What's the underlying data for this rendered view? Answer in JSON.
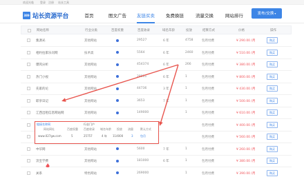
{
  "topbar": {
    "welcome": "欢迎光临",
    "login": "登录",
    "register": "注册",
    "tools": "站长工具"
  },
  "header": {
    "logo_mark": "389",
    "logo_text": "站长资源平台",
    "nav": [
      "首页",
      "图文广告",
      "友链买卖",
      "免费换链",
      "流量交换",
      "网站排行"
    ],
    "active_nav": "友链买卖",
    "publish_label": "发布/交换",
    "publish_caret": "▾",
    "accent": "#3d85e6"
  },
  "table": {
    "headers": [
      "网站名称",
      "行业分类",
      "百度权重",
      "百度收录",
      "域名年龄",
      "投放",
      "结算方式",
      "价格",
      "操作"
    ],
    "rows": [
      {
        "name": "集源光",
        "category": "其他网站",
        "weight": "",
        "index": "29527",
        "age": "6 年",
        "count": "4758",
        "settle": "包月付费",
        "price": "¥ 290.00 /月",
        "action": "购买"
      },
      {
        "name": "相约拉家乐问网",
        "category": "技术类",
        "weight": "",
        "index": "5564",
        "age": "6 年",
        "count": "2460",
        "settle": "包月付费",
        "price": "¥ 510.00 /月",
        "action": "购买"
      },
      {
        "name": "爆风分析",
        "category": "其他网站",
        "weight": "",
        "index": "454374",
        "age": "6 年",
        "count": "266",
        "settle": "包月付费",
        "price": "¥ 380.00 /月",
        "action": "购买"
      },
      {
        "name": "热门小视",
        "category": "其他网站",
        "weight": "",
        "index": "28911",
        "age": "6 年",
        "count": "1",
        "settle": "包月付费",
        "price": "¥ 800.00 /月",
        "action": "购买"
      },
      {
        "name": "先家的论",
        "category": "其他网站",
        "weight": "",
        "index": "44736",
        "age": "3 年",
        "count": "1",
        "settle": "包月付费",
        "price": "¥ 430.00 /月",
        "action": "购买"
      },
      {
        "name": "职享日记",
        "category": "其他网站",
        "weight": "",
        "index": "3653",
        "age": "7 年",
        "count": "1",
        "settle": "包月付费",
        "price": "¥ 500.00 /月",
        "action": "购买"
      },
      {
        "name": "江西出租信息网站网",
        "category": "其他网站",
        "weight": "",
        "index": "149000",
        "age": "",
        "count": "1",
        "settle": "包月付费",
        "price": "¥ 610.00 /月",
        "action": "购买"
      },
      {
        "name": "",
        "category": "",
        "weight": "",
        "index": "",
        "age": "",
        "count": "",
        "settle": "包月付费",
        "price": "¥ 400.00 /月",
        "action": "购买"
      },
      {
        "name": "",
        "category": "",
        "weight": "",
        "index": "",
        "age": "",
        "count": "",
        "settle": "包月付费",
        "price": "¥ 560.00 /月",
        "action": "购买"
      },
      {
        "name": "中华网",
        "category": "其他网站",
        "weight": "",
        "index": "5600",
        "age": "7 年",
        "count": "1",
        "settle": "包月付费",
        "price": "¥ 260.00 /月",
        "action": "购买"
      },
      {
        "name": "流宝学费",
        "category": "其他网站",
        "weight": "",
        "index": "181000",
        "age": "6 年",
        "count": "1",
        "settle": "包月付费",
        "price": "¥ 380.00 /月",
        "action": "购买"
      },
      {
        "name": "关系",
        "category": "特色网站",
        "weight": "",
        "index": "269000",
        "age": "",
        "count": "1",
        "settle": "包月付费",
        "price": "¥ 390.00 /月",
        "action": "购买"
      }
    ]
  },
  "popup": {
    "title": "链接名称网",
    "category": "行业门户",
    "headers": [
      "网站网址",
      "百度权重",
      "百度收录",
      "域名年龄",
      "投放",
      "流量",
      "默认方式"
    ],
    "values": [
      "www.027gw.com",
      "5",
      "25757",
      "4 年",
      "114000",
      "3",
      "包月"
    ]
  },
  "colors": {
    "price_red": "#f0545a",
    "annotation_red": "#e8554e"
  }
}
